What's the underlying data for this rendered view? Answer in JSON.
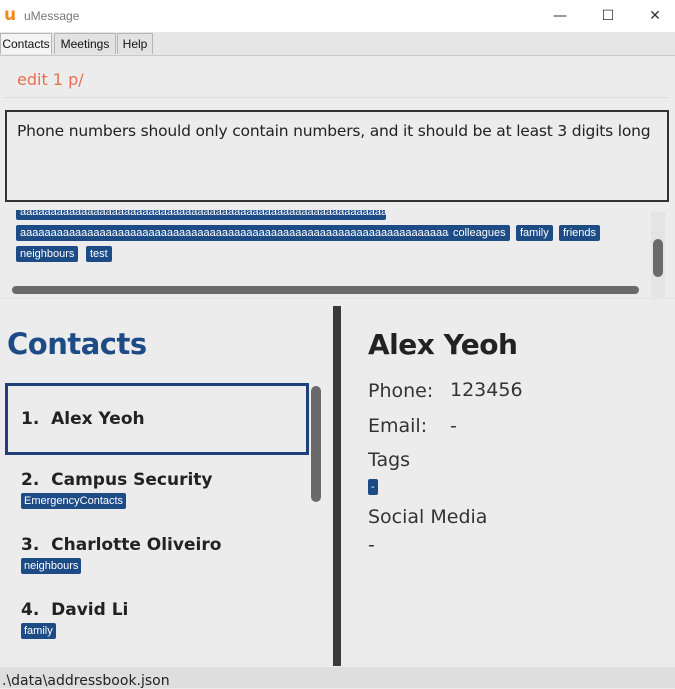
{
  "window": {
    "title": "uMessage",
    "minimize": "—",
    "maximize": "☐",
    "close": "✕"
  },
  "menu": {
    "items": [
      "Contacts",
      "Meetings",
      "Help"
    ]
  },
  "command": {
    "text": "edit 1 p/"
  },
  "result": {
    "text": "Phone numbers should only contain numbers, and it should be at least 3 digits long"
  },
  "tag_panel": {
    "tags": [
      "aaaaaaaaaaaaaaaaaaaaaaaaaaaaaaaaaaaaaaaaaaaaaaaaaaaaaaaaaaaaaaaaaaaa",
      "aaaaaaaaaaaaaaaaaaaaaaaaaaaaaaaaaaaaaaaaaaaaaaaaaaaaaaaaaaaaaaaaaaaaaaaaaa",
      "colleagues",
      "family",
      "friends",
      "neighbours",
      "test"
    ]
  },
  "contacts": {
    "heading": "Contacts",
    "list": [
      {
        "index": "1.",
        "name": "Alex Yeoh",
        "tag": ""
      },
      {
        "index": "2.",
        "name": "Campus Security",
        "tag": "EmergencyContacts"
      },
      {
        "index": "3.",
        "name": "Charlotte Oliveiro",
        "tag": "neighbours"
      },
      {
        "index": "4.",
        "name": "David Li",
        "tag": "family"
      }
    ]
  },
  "detail": {
    "name": "Alex Yeoh",
    "phone_label": "Phone:",
    "phone_value": "123456",
    "email_label": "Email:",
    "email_value": "-",
    "tags_label": "Tags",
    "tag_value": "-",
    "social_label": "Social Media",
    "social_value": "-"
  },
  "status": {
    "path": ".\\data\\addressbook.json"
  },
  "colors": {
    "accent": "#1d4b86",
    "command": "#e4704f",
    "app_icon": "#f08a1a"
  }
}
